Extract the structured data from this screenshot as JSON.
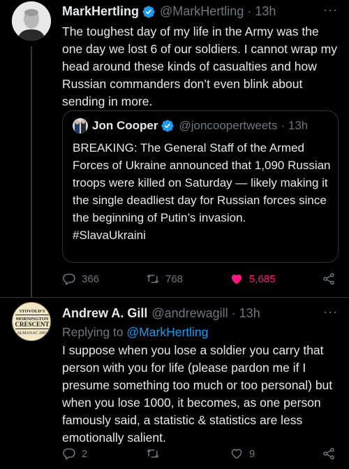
{
  "tweet1": {
    "name": "MarkHertling",
    "handle": "@MarkHertling",
    "time": "· 13h",
    "text": "The toughest day of my life in the Army was the one day we lost 6 of our soldiers. I cannot wrap my head around these kinds of casualties and how Russian commanders don’t even blink about sending in more.",
    "more": "···",
    "quote": {
      "name": "Jon Cooper",
      "handle": "@joncoopertweets",
      "time": "· 13h",
      "text": "BREAKING: The General Staff of the Armed Forces of Ukraine announced that 1,090 Russian troops were killed on Saturday — likely making it the single deadliest day for Russian forces since the beginning of Putin’s invasion.",
      "hashtag": "#SlavaUkraini"
    },
    "actions": {
      "replies": "366",
      "retweets": "768",
      "likes": "5,685"
    }
  },
  "tweet2": {
    "name": "Andrew A. Gill",
    "handle": "@andrewagill",
    "time": "· 13h",
    "replying_prefix": "Replying to ",
    "replying_to": "@MarkHertling",
    "text": "I suppose when you lose a soldier you carry that person with you for life (please pardon me if I presume something too much or too personal) but when you lose 1000, it becomes, as one person famously said, a statistic & statistics are less emotionally salient.",
    "more": "···",
    "avatar_text": [
      "STOVOLD'S",
      "MORNINGTON",
      "CRESCENT",
      "ALMANAC 2001"
    ],
    "actions": {
      "replies": "2",
      "retweets": "",
      "likes": "9"
    }
  },
  "colors": {
    "background": "#000000",
    "text": "#e7e9ea",
    "muted": "#71767b",
    "link": "#1d9bf0",
    "like": "#f91880",
    "verified": "#1d9bf0"
  }
}
